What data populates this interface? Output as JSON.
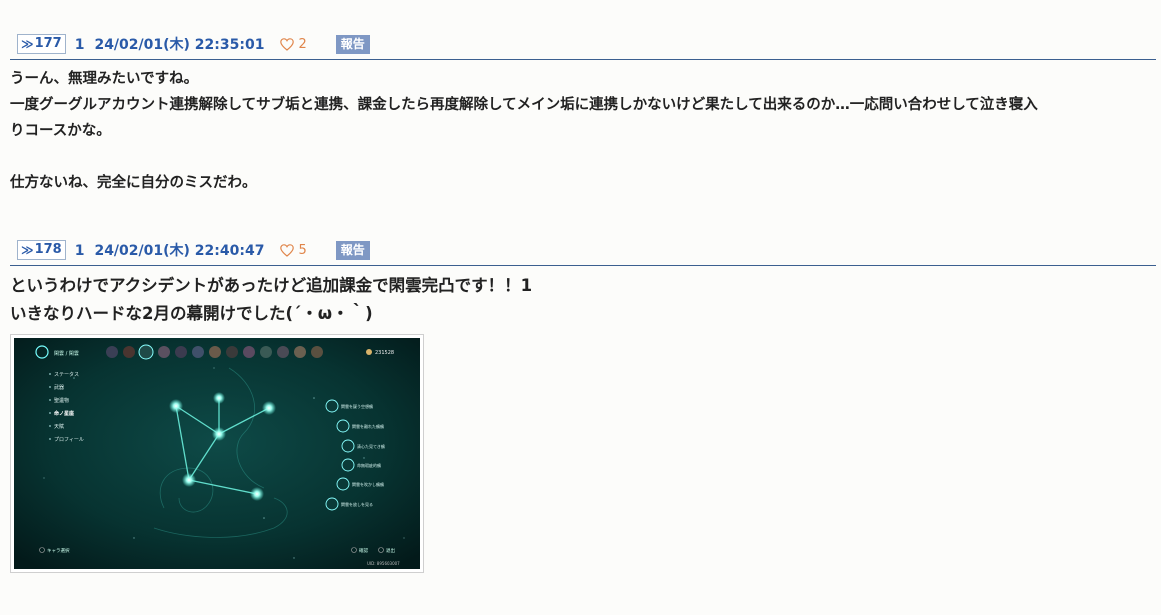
{
  "posts": [
    {
      "anchor": "177",
      "user": "1",
      "datetime": "24/02/01(木) 22:35:01",
      "likes": "2",
      "report_label": "報告",
      "body": "うーん、無理みたいですね。\n一度グーグルアカウント連携解除してサブ垢と連携、課金したら再度解除してメイン垢に連携しかないけど果たして出来るのか…一応問い合わせして泣き寝入\nりコースかな。\n\n仕方ないね、完全に自分のミスだわ。"
    },
    {
      "anchor": "178",
      "user": "1",
      "datetime": "24/02/01(木) 22:40:47",
      "likes": "5",
      "report_label": "報告",
      "body": "というわけでアクシデントがあったけど追加課金で閑雲完凸です！！1\nいきなりハードな2月の幕開けでした(´・ω・｀)"
    }
  ],
  "screenshot": {
    "breadcrumb": "閑雲 / 閑雲",
    "currency": "231528",
    "menu": [
      "ステータス",
      "武器",
      "聖遺物",
      "命ノ星座",
      "天賦",
      "プロフィール"
    ],
    "constellations": [
      "閑雲を疑う空想鶴",
      "閑雲を離れた鶴鶴",
      "清心た見てき鶴",
      "命無瑕疵的鶴",
      "閑雲を吹かし鶴鶴",
      "閑雲を放しを見る"
    ],
    "footer_left": "キャラ選択",
    "footer_confirm": "確認",
    "footer_back": "退出",
    "uid": "UID: 895603007",
    "colors": {
      "bg": "#052a2a",
      "glow": "#5ff5e0"
    }
  }
}
